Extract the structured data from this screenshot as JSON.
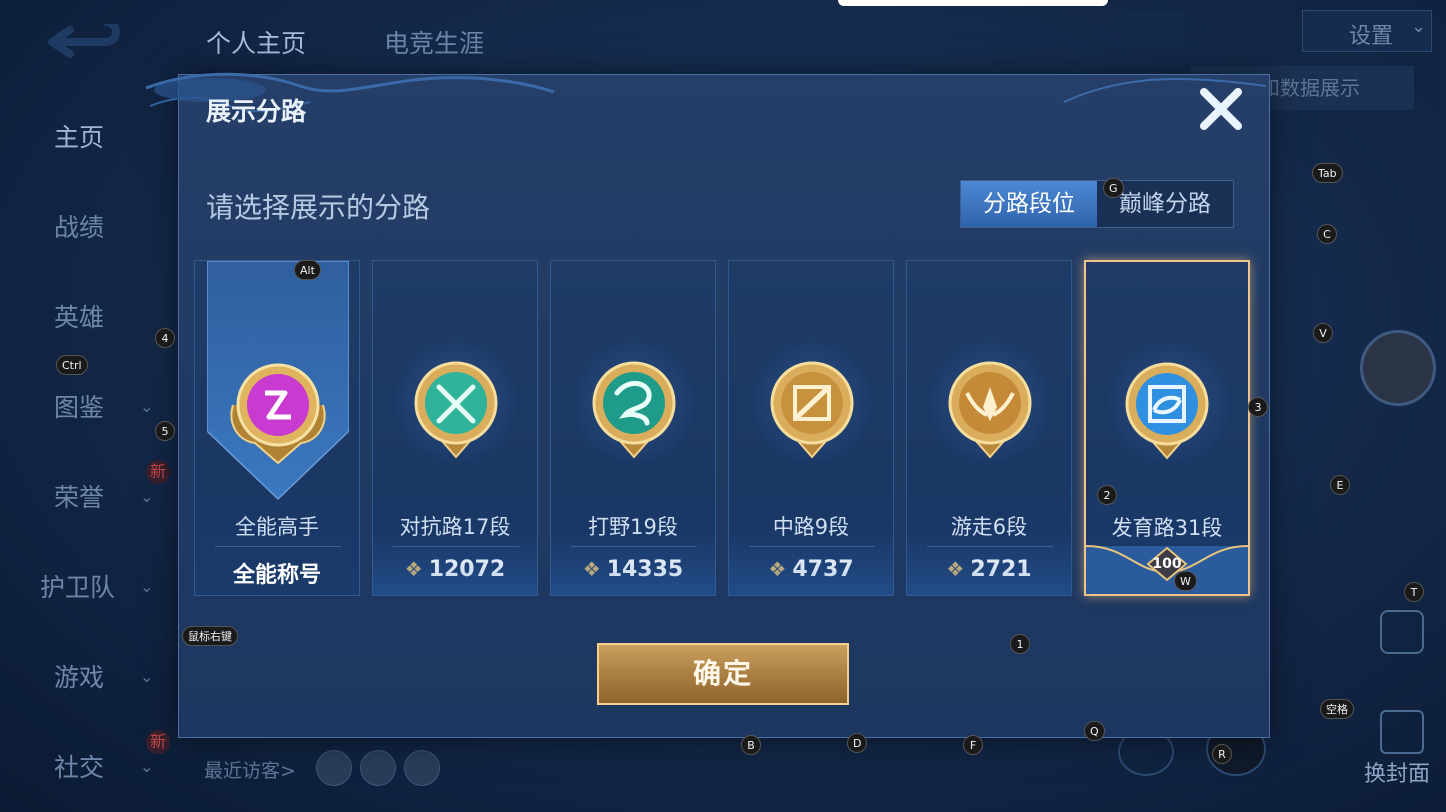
{
  "background": {
    "top_tabs": [
      "个人主页",
      "电竞生涯"
    ],
    "settings_label": "设置",
    "sub_header": "定和数据展示",
    "nav": [
      {
        "label": "主页",
        "active": true
      },
      {
        "label": "战绩"
      },
      {
        "label": "英雄"
      },
      {
        "label": "图鉴",
        "chevron": true
      },
      {
        "label": "荣誉",
        "chevron": true,
        "badge": "新"
      },
      {
        "label": "护卫队",
        "chevron": true
      },
      {
        "label": "游戏",
        "chevron": true
      },
      {
        "label": "社交",
        "chevron": true,
        "badge": "新"
      }
    ],
    "visitors_label": "最近访客>",
    "cover_label": "换封面",
    "new_badge": "新"
  },
  "dialog": {
    "title": "展示分路",
    "prompt": "请选择展示的分路",
    "segments": [
      {
        "label": "分路段位",
        "selected": true
      },
      {
        "label": "巅峰分路",
        "selected": false
      }
    ],
    "cards": [
      {
        "name": "全能高手",
        "value": "全能称号",
        "emblem": "all-round-emblem-icon",
        "color": "#c83ad0"
      },
      {
        "name": "对抗路17段",
        "value": "12072",
        "emblem": "clash-lane-emblem-icon",
        "color": "#2fb39a"
      },
      {
        "name": "打野19段",
        "value": "14335",
        "emblem": "jungle-emblem-icon",
        "color": "#1f9b8a"
      },
      {
        "name": "中路9段",
        "value": "4737",
        "emblem": "mid-lane-emblem-icon",
        "color": "#c7913e"
      },
      {
        "name": "游走6段",
        "value": "2721",
        "emblem": "roam-emblem-icon",
        "color": "#c48a38"
      },
      {
        "name": "发育路31段",
        "value": "100",
        "emblem": "farm-lane-emblem-icon",
        "color": "#2f8fe0",
        "selected": true
      }
    ],
    "confirm_label": "确定"
  },
  "key_hints": [
    {
      "key": "Alt"
    },
    {
      "key": "Ctrl"
    },
    {
      "key": "4"
    },
    {
      "key": "5"
    },
    {
      "key": "G"
    },
    {
      "key": "Tab"
    },
    {
      "key": "C"
    },
    {
      "key": "V"
    },
    {
      "key": "3"
    },
    {
      "key": "2"
    },
    {
      "key": "E"
    },
    {
      "key": "W"
    },
    {
      "key": "T"
    },
    {
      "key": "1"
    },
    {
      "key": "鼠标右键"
    },
    {
      "key": "空格"
    },
    {
      "key": "B"
    },
    {
      "key": "D"
    },
    {
      "key": "F"
    },
    {
      "key": "Q"
    },
    {
      "key": "R"
    }
  ],
  "colors": {
    "accent": "#3f7ac6",
    "gold": "#d8b56c",
    "selected_border": "#f0c38a"
  }
}
